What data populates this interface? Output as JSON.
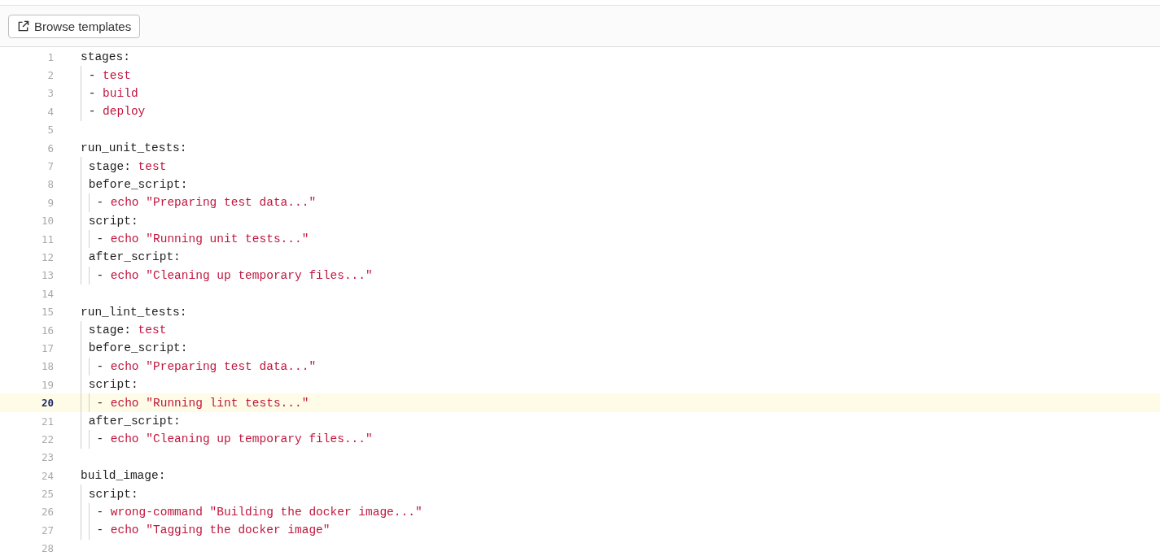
{
  "toolbar": {
    "browse_button": {
      "label": "Browse templates"
    }
  },
  "editor": {
    "lines": [
      {
        "number": "1",
        "current": false,
        "tokens": [
          {
            "kind": "key",
            "text": "stages:"
          }
        ],
        "children": [
          {
            "number": "2",
            "current": false,
            "tokens": [
              {
                "kind": "dash",
                "text": "-"
              },
              {
                "kind": "value",
                "text": "test"
              }
            ]
          },
          {
            "number": "3",
            "current": false,
            "tokens": [
              {
                "kind": "dash",
                "text": "-"
              },
              {
                "kind": "value",
                "text": "build"
              }
            ]
          },
          {
            "number": "4",
            "current": false,
            "tokens": [
              {
                "kind": "dash",
                "text": "-"
              },
              {
                "kind": "value",
                "text": "deploy"
              }
            ]
          }
        ]
      },
      {
        "number": "5",
        "current": false
      },
      {
        "number": "6",
        "current": false,
        "tokens": [
          {
            "kind": "key",
            "text": "run_unit_tests:"
          }
        ],
        "children": [
          {
            "number": "7",
            "current": false,
            "tokens": [
              {
                "kind": "key",
                "text": "stage:"
              },
              {
                "kind": "value",
                "text": "test"
              }
            ]
          },
          {
            "number": "8",
            "current": false,
            "tokens": [
              {
                "kind": "key",
                "text": "before_script:"
              }
            ],
            "children": [
              {
                "number": "9",
                "current": false,
                "tokens": [
                  {
                    "kind": "dash",
                    "text": "-"
                  },
                  {
                    "kind": "value",
                    "text": "echo \"Preparing test data...\""
                  }
                ]
              }
            ]
          },
          {
            "number": "10",
            "current": false,
            "tokens": [
              {
                "kind": "key",
                "text": "script:"
              }
            ],
            "children": [
              {
                "number": "11",
                "current": false,
                "tokens": [
                  {
                    "kind": "dash",
                    "text": "-"
                  },
                  {
                    "kind": "value",
                    "text": "echo \"Running unit tests...\""
                  }
                ]
              }
            ]
          },
          {
            "number": "12",
            "current": false,
            "tokens": [
              {
                "kind": "key",
                "text": "after_script:"
              }
            ],
            "children": [
              {
                "number": "13",
                "current": false,
                "tokens": [
                  {
                    "kind": "dash",
                    "text": "-"
                  },
                  {
                    "kind": "value",
                    "text": "echo \"Cleaning up temporary files...\""
                  }
                ]
              }
            ]
          }
        ]
      },
      {
        "number": "14",
        "current": false
      },
      {
        "number": "15",
        "current": false,
        "tokens": [
          {
            "kind": "key",
            "text": "run_lint_tests:"
          }
        ],
        "children": [
          {
            "number": "16",
            "current": false,
            "tokens": [
              {
                "kind": "key",
                "text": "stage:"
              },
              {
                "kind": "value",
                "text": "test"
              }
            ]
          },
          {
            "number": "17",
            "current": false,
            "tokens": [
              {
                "kind": "key",
                "text": "before_script:"
              }
            ],
            "children": [
              {
                "number": "18",
                "current": false,
                "tokens": [
                  {
                    "kind": "dash",
                    "text": "-"
                  },
                  {
                    "kind": "value",
                    "text": "echo \"Preparing test data...\""
                  }
                ]
              }
            ]
          },
          {
            "number": "19",
            "current": false,
            "tokens": [
              {
                "kind": "key",
                "text": "script:"
              }
            ],
            "children": [
              {
                "number": "20",
                "current": true,
                "tokens": [
                  {
                    "kind": "dash",
                    "text": "-"
                  },
                  {
                    "kind": "value",
                    "text": "echo \"Running lint tests...\""
                  }
                ]
              }
            ]
          },
          {
            "number": "21",
            "current": false,
            "tokens": [
              {
                "kind": "key",
                "text": "after_script:"
              }
            ],
            "children": [
              {
                "number": "22",
                "current": false,
                "tokens": [
                  {
                    "kind": "dash",
                    "text": "-"
                  },
                  {
                    "kind": "value",
                    "text": "echo \"Cleaning up temporary files...\""
                  }
                ]
              }
            ]
          }
        ]
      },
      {
        "number": "23",
        "current": false
      },
      {
        "number": "24",
        "current": false,
        "tokens": [
          {
            "kind": "key",
            "text": "build_image:"
          }
        ],
        "children": [
          {
            "number": "25",
            "current": false,
            "tokens": [
              {
                "kind": "key",
                "text": "script:"
              }
            ],
            "children": [
              {
                "number": "26",
                "current": false,
                "tokens": [
                  {
                    "kind": "dash",
                    "text": "-"
                  },
                  {
                    "kind": "value",
                    "text": "wrong-command \"Building the docker image...\""
                  }
                ]
              },
              {
                "number": "27",
                "current": false,
                "tokens": [
                  {
                    "kind": "dash",
                    "text": "-"
                  },
                  {
                    "kind": "value",
                    "text": "echo \"Tagging the docker image\""
                  }
                ]
              }
            ]
          }
        ]
      },
      {
        "number": "28",
        "current": false
      }
    ]
  }
}
